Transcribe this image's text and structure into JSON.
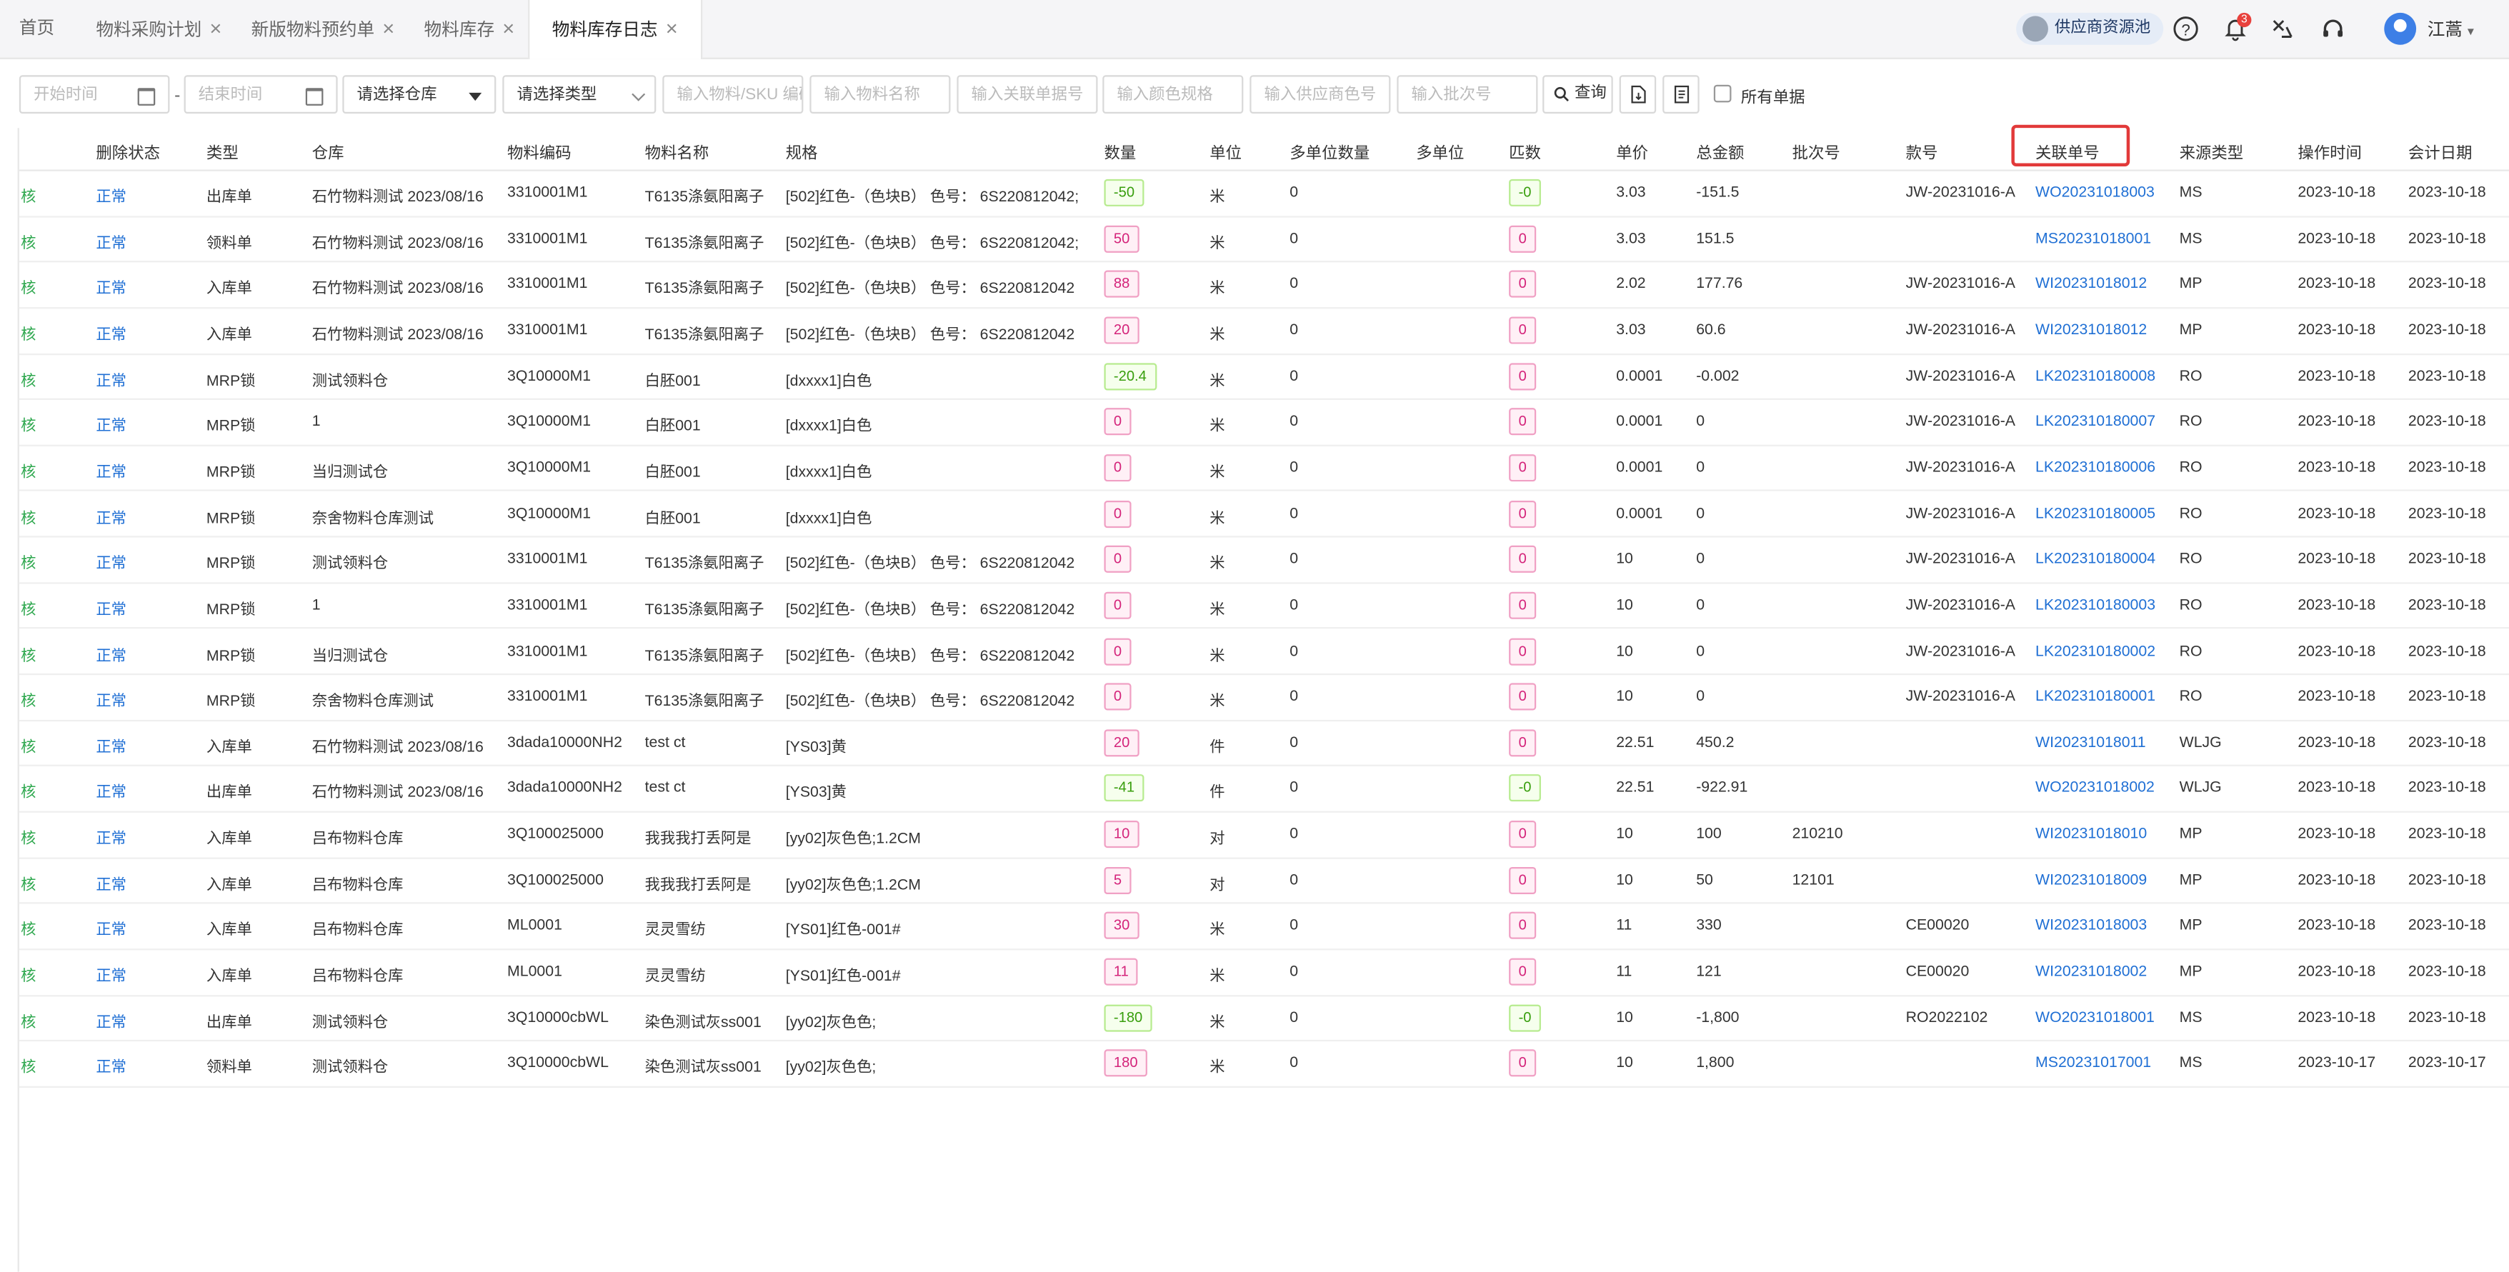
{
  "tabs": [
    {
      "label": "首页",
      "closable": false
    },
    {
      "label": "物料采购计划",
      "closable": true
    },
    {
      "label": "新版物料预约单",
      "closable": true
    },
    {
      "label": "物料库存",
      "closable": true
    },
    {
      "label": "物料库存日志",
      "closable": true,
      "active": true
    }
  ],
  "header": {
    "supplier_pool": "供应商资源池",
    "notification_count": "3",
    "username": "江蒿",
    "icons": [
      "help-icon",
      "bell-icon",
      "tool-icon",
      "headset-icon",
      "user-avatar-icon"
    ]
  },
  "filters": {
    "start_time": "开始时间",
    "end_time": "结束时间",
    "warehouse": "请选择仓库",
    "type": "请选择类型",
    "material_sku": "输入物料/SKU 编码",
    "material_name": "输入物料名称",
    "related_no": "输入关联单据号",
    "color_spec": "输入颜色规格",
    "supplier_color": "输入供应商色号",
    "batch_no": "输入批次号",
    "query": "查询",
    "all_docs": "所有单据"
  },
  "table": {
    "columns": [
      "删除状态",
      "类型",
      "仓库",
      "物料编码",
      "物料名称",
      "规格",
      "数量",
      "单位",
      "多单位数量",
      "多单位",
      "匹数",
      "单价",
      "总金额",
      "批次号",
      "款号",
      "关联单号",
      "来源类型",
      "操作时间",
      "会计日期"
    ],
    "rows": [
      {
        "check": "核",
        "status": "正常",
        "type": "出库单",
        "warehouse": "石竹物料测试 2023/08/16",
        "code": "3310001M1",
        "name": "T6135涤氨阳离子",
        "spec": "[502]红色-（色块B） 色号： 6S220812042;",
        "qty": "-50",
        "qty_neg": true,
        "unit": "米",
        "munit_qty": "0",
        "munit": "",
        "pieces": "-0",
        "pieces_neg": true,
        "price": "3.03",
        "total": "-151.5",
        "batch": "",
        "style": "JW-20231016-A",
        "related": "WO20231018003",
        "source": "MS",
        "op_time": "2023-10-18",
        "acc_date": "2023-10-18"
      },
      {
        "check": "核",
        "status": "正常",
        "type": "领料单",
        "warehouse": "石竹物料测试 2023/08/16",
        "code": "3310001M1",
        "name": "T6135涤氨阳离子",
        "spec": "[502]红色-（色块B） 色号： 6S220812042;",
        "qty": "50",
        "qty_neg": false,
        "unit": "米",
        "munit_qty": "0",
        "munit": "",
        "pieces": "0",
        "pieces_neg": false,
        "price": "3.03",
        "total": "151.5",
        "batch": "",
        "style": "",
        "related": "MS20231018001",
        "source": "MS",
        "op_time": "2023-10-18",
        "acc_date": "2023-10-18"
      },
      {
        "check": "核",
        "status": "正常",
        "type": "入库单",
        "warehouse": "石竹物料测试 2023/08/16",
        "code": "3310001M1",
        "name": "T6135涤氨阳离子",
        "spec": "[502]红色-（色块B） 色号： 6S220812042",
        "qty": "88",
        "qty_neg": false,
        "unit": "米",
        "munit_qty": "0",
        "munit": "",
        "pieces": "0",
        "pieces_neg": false,
        "price": "2.02",
        "total": "177.76",
        "batch": "",
        "style": "JW-20231016-A",
        "related": "WI20231018012",
        "source": "MP",
        "op_time": "2023-10-18",
        "acc_date": "2023-10-18"
      },
      {
        "check": "核",
        "status": "正常",
        "type": "入库单",
        "warehouse": "石竹物料测试 2023/08/16",
        "code": "3310001M1",
        "name": "T6135涤氨阳离子",
        "spec": "[502]红色-（色块B） 色号： 6S220812042",
        "qty": "20",
        "qty_neg": false,
        "unit": "米",
        "munit_qty": "0",
        "munit": "",
        "pieces": "0",
        "pieces_neg": false,
        "price": "3.03",
        "total": "60.6",
        "batch": "",
        "style": "JW-20231016-A",
        "related": "WI20231018012",
        "source": "MP",
        "op_time": "2023-10-18",
        "acc_date": "2023-10-18"
      },
      {
        "check": "核",
        "status": "正常",
        "type": "MRP锁",
        "warehouse": "测试领料仓",
        "code": "3Q10000M1",
        "name": "白胚001",
        "spec": "[dxxxx1]白色",
        "qty": "-20.4",
        "qty_neg": true,
        "unit": "米",
        "munit_qty": "0",
        "munit": "",
        "pieces": "0",
        "pieces_neg": false,
        "price": "0.0001",
        "total": "-0.002",
        "batch": "",
        "style": "JW-20231016-A",
        "related": "LK202310180008",
        "source": "RO",
        "op_time": "2023-10-18",
        "acc_date": "2023-10-18"
      },
      {
        "check": "核",
        "status": "正常",
        "type": "MRP锁",
        "warehouse": "1",
        "code": "3Q10000M1",
        "name": "白胚001",
        "spec": "[dxxxx1]白色",
        "qty": "0",
        "qty_neg": false,
        "unit": "米",
        "munit_qty": "0",
        "munit": "",
        "pieces": "0",
        "pieces_neg": false,
        "price": "0.0001",
        "total": "0",
        "batch": "",
        "style": "JW-20231016-A",
        "related": "LK202310180007",
        "source": "RO",
        "op_time": "2023-10-18",
        "acc_date": "2023-10-18"
      },
      {
        "check": "核",
        "status": "正常",
        "type": "MRP锁",
        "warehouse": "当归测试仓",
        "code": "3Q10000M1",
        "name": "白胚001",
        "spec": "[dxxxx1]白色",
        "qty": "0",
        "qty_neg": false,
        "unit": "米",
        "munit_qty": "0",
        "munit": "",
        "pieces": "0",
        "pieces_neg": false,
        "price": "0.0001",
        "total": "0",
        "batch": "",
        "style": "JW-20231016-A",
        "related": "LK202310180006",
        "source": "RO",
        "op_time": "2023-10-18",
        "acc_date": "2023-10-18"
      },
      {
        "check": "核",
        "status": "正常",
        "type": "MRP锁",
        "warehouse": "奈舍物料仓库测试",
        "code": "3Q10000M1",
        "name": "白胚001",
        "spec": "[dxxxx1]白色",
        "qty": "0",
        "qty_neg": false,
        "unit": "米",
        "munit_qty": "0",
        "munit": "",
        "pieces": "0",
        "pieces_neg": false,
        "price": "0.0001",
        "total": "0",
        "batch": "",
        "style": "JW-20231016-A",
        "related": "LK202310180005",
        "source": "RO",
        "op_time": "2023-10-18",
        "acc_date": "2023-10-18"
      },
      {
        "check": "核",
        "status": "正常",
        "type": "MRP锁",
        "warehouse": "测试领料仓",
        "code": "3310001M1",
        "name": "T6135涤氨阳离子",
        "spec": "[502]红色-（色块B） 色号： 6S220812042",
        "qty": "0",
        "qty_neg": false,
        "unit": "米",
        "munit_qty": "0",
        "munit": "",
        "pieces": "0",
        "pieces_neg": false,
        "price": "10",
        "total": "0",
        "batch": "",
        "style": "JW-20231016-A",
        "related": "LK202310180004",
        "source": "RO",
        "op_time": "2023-10-18",
        "acc_date": "2023-10-18"
      },
      {
        "check": "核",
        "status": "正常",
        "type": "MRP锁",
        "warehouse": "1",
        "code": "3310001M1",
        "name": "T6135涤氨阳离子",
        "spec": "[502]红色-（色块B） 色号： 6S220812042",
        "qty": "0",
        "qty_neg": false,
        "unit": "米",
        "munit_qty": "0",
        "munit": "",
        "pieces": "0",
        "pieces_neg": false,
        "price": "10",
        "total": "0",
        "batch": "",
        "style": "JW-20231016-A",
        "related": "LK202310180003",
        "source": "RO",
        "op_time": "2023-10-18",
        "acc_date": "2023-10-18"
      },
      {
        "check": "核",
        "status": "正常",
        "type": "MRP锁",
        "warehouse": "当归测试仓",
        "code": "3310001M1",
        "name": "T6135涤氨阳离子",
        "spec": "[502]红色-（色块B） 色号： 6S220812042",
        "qty": "0",
        "qty_neg": false,
        "unit": "米",
        "munit_qty": "0",
        "munit": "",
        "pieces": "0",
        "pieces_neg": false,
        "price": "10",
        "total": "0",
        "batch": "",
        "style": "JW-20231016-A",
        "related": "LK202310180002",
        "source": "RO",
        "op_time": "2023-10-18",
        "acc_date": "2023-10-18"
      },
      {
        "check": "核",
        "status": "正常",
        "type": "MRP锁",
        "warehouse": "奈舍物料仓库测试",
        "code": "3310001M1",
        "name": "T6135涤氨阳离子",
        "spec": "[502]红色-（色块B） 色号： 6S220812042",
        "qty": "0",
        "qty_neg": false,
        "unit": "米",
        "munit_qty": "0",
        "munit": "",
        "pieces": "0",
        "pieces_neg": false,
        "price": "10",
        "total": "0",
        "batch": "",
        "style": "JW-20231016-A",
        "related": "LK202310180001",
        "source": "RO",
        "op_time": "2023-10-18",
        "acc_date": "2023-10-18"
      },
      {
        "check": "核",
        "status": "正常",
        "type": "入库单",
        "warehouse": "石竹物料测试 2023/08/16",
        "code": "3dada10000NH2",
        "name": "test ct",
        "spec": "[YS03]黄",
        "qty": "20",
        "qty_neg": false,
        "unit": "件",
        "munit_qty": "0",
        "munit": "",
        "pieces": "0",
        "pieces_neg": false,
        "price": "22.51",
        "total": "450.2",
        "batch": "",
        "style": "",
        "related": "WI20231018011",
        "source": "WLJG",
        "op_time": "2023-10-18",
        "acc_date": "2023-10-18"
      },
      {
        "check": "核",
        "status": "正常",
        "type": "出库单",
        "warehouse": "石竹物料测试 2023/08/16",
        "code": "3dada10000NH2",
        "name": "test ct",
        "spec": "[YS03]黄",
        "qty": "-41",
        "qty_neg": true,
        "unit": "件",
        "munit_qty": "0",
        "munit": "",
        "pieces": "-0",
        "pieces_neg": true,
        "price": "22.51",
        "total": "-922.91",
        "batch": "",
        "style": "",
        "related": "WO20231018002",
        "source": "WLJG",
        "op_time": "2023-10-18",
        "acc_date": "2023-10-18"
      },
      {
        "check": "核",
        "status": "正常",
        "type": "入库单",
        "warehouse": "吕布物料仓库",
        "code": "3Q100025000",
        "name": "我我我打丢阿是",
        "spec": "[yy02]灰色色;1.2CM",
        "qty": "10",
        "qty_neg": false,
        "unit": "对",
        "munit_qty": "0",
        "munit": "",
        "pieces": "0",
        "pieces_neg": false,
        "price": "10",
        "total": "100",
        "batch": "210210",
        "style": "",
        "related": "WI20231018010",
        "source": "MP",
        "op_time": "2023-10-18",
        "acc_date": "2023-10-18"
      },
      {
        "check": "核",
        "status": "正常",
        "type": "入库单",
        "warehouse": "吕布物料仓库",
        "code": "3Q100025000",
        "name": "我我我打丢阿是",
        "spec": "[yy02]灰色色;1.2CM",
        "qty": "5",
        "qty_neg": false,
        "unit": "对",
        "munit_qty": "0",
        "munit": "",
        "pieces": "0",
        "pieces_neg": false,
        "price": "10",
        "total": "50",
        "batch": "12101",
        "style": "",
        "related": "WI20231018009",
        "source": "MP",
        "op_time": "2023-10-18",
        "acc_date": "2023-10-18"
      },
      {
        "check": "核",
        "status": "正常",
        "type": "入库单",
        "warehouse": "吕布物料仓库",
        "code": "ML0001",
        "name": "灵灵雪纺",
        "spec": "[YS01]红色-001#",
        "qty": "30",
        "qty_neg": false,
        "unit": "米",
        "munit_qty": "0",
        "munit": "",
        "pieces": "0",
        "pieces_neg": false,
        "price": "11",
        "total": "330",
        "batch": "",
        "style": "CE00020",
        "related": "WI20231018003",
        "source": "MP",
        "op_time": "2023-10-18",
        "acc_date": "2023-10-18"
      },
      {
        "check": "核",
        "status": "正常",
        "type": "入库单",
        "warehouse": "吕布物料仓库",
        "code": "ML0001",
        "name": "灵灵雪纺",
        "spec": "[YS01]红色-001#",
        "qty": "11",
        "qty_neg": false,
        "unit": "米",
        "munit_qty": "0",
        "munit": "",
        "pieces": "0",
        "pieces_neg": false,
        "price": "11",
        "total": "121",
        "batch": "",
        "style": "CE00020",
        "related": "WI20231018002",
        "source": "MP",
        "op_time": "2023-10-18",
        "acc_date": "2023-10-18"
      },
      {
        "check": "核",
        "status": "正常",
        "type": "出库单",
        "warehouse": "测试领料仓",
        "code": "3Q10000cbWL",
        "name": "染色测试灰ss001",
        "spec": "[yy02]灰色色;",
        "qty": "-180",
        "qty_neg": true,
        "unit": "米",
        "munit_qty": "0",
        "munit": "",
        "pieces": "-0",
        "pieces_neg": true,
        "price": "10",
        "total": "-1,800",
        "batch": "",
        "style": "RO2022102",
        "related": "WO20231018001",
        "source": "MS",
        "op_time": "2023-10-18",
        "acc_date": "2023-10-18"
      },
      {
        "check": "核",
        "status": "正常",
        "type": "领料单",
        "warehouse": "测试领料仓",
        "code": "3Q10000cbWL",
        "name": "染色测试灰ss001",
        "spec": "[yy02]灰色色;",
        "qty": "180",
        "qty_neg": false,
        "unit": "米",
        "munit_qty": "0",
        "munit": "",
        "pieces": "0",
        "pieces_neg": false,
        "price": "10",
        "total": "1,800",
        "batch": "",
        "style": "",
        "related": "MS20231017001",
        "source": "MS",
        "op_time": "2023-10-17",
        "acc_date": "2023-10-17"
      }
    ]
  },
  "colors": {
    "link": "#1f6fd4",
    "check": "#2fa84f",
    "highlight": "#e23a3a",
    "badge": "#e8413d"
  }
}
